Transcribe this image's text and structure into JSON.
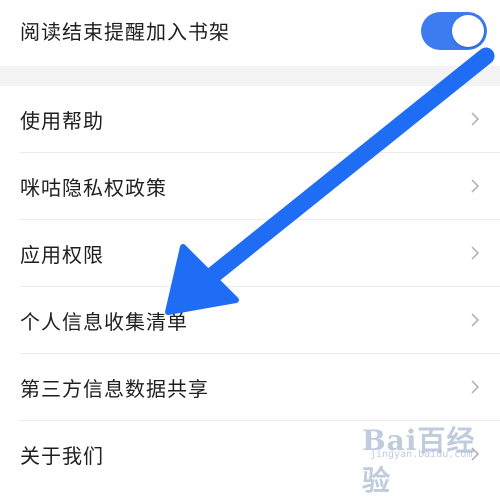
{
  "top": {
    "label": "阅读结束提醒加入书架",
    "toggle_on": true
  },
  "colors": {
    "accent": "#3d7bf0",
    "annotation_arrow": "#1f6df5",
    "divider": "#ebebeb",
    "gap": "#f3f3f3"
  },
  "list": [
    {
      "label": "使用帮助",
      "icon": "chevron-right-icon"
    },
    {
      "label": "咪咕隐私权政策",
      "icon": "chevron-right-icon"
    },
    {
      "label": "应用权限",
      "icon": "chevron-right-icon"
    },
    {
      "label": "个人信息收集清单",
      "icon": "chevron-right-icon"
    },
    {
      "label": "第三方信息数据共享",
      "icon": "chevron-right-icon"
    },
    {
      "label": "关于我们",
      "icon": "chevron-right-icon"
    }
  ],
  "watermark": {
    "text": "Bai百经验",
    "sub": "jingyan.baidu.com"
  }
}
